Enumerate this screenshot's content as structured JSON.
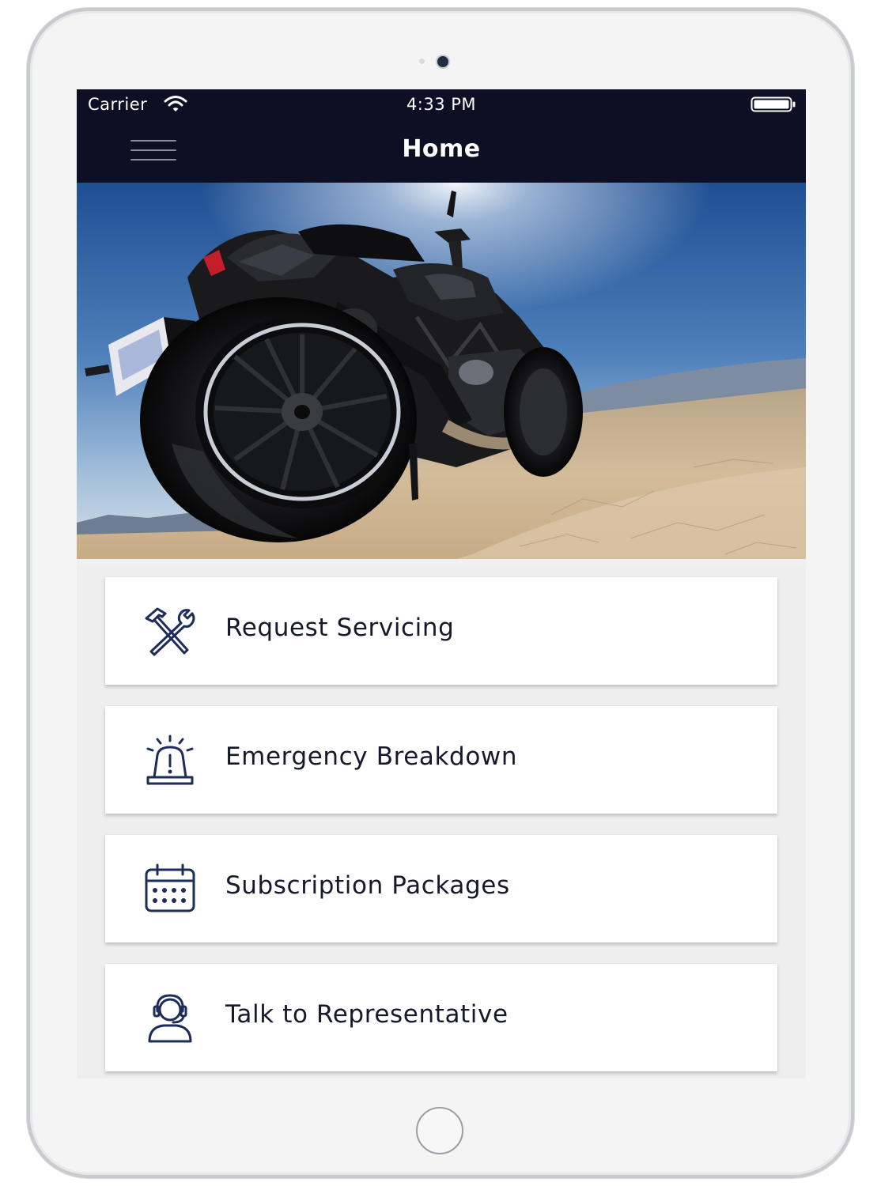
{
  "status_bar": {
    "carrier": "Carrier",
    "time": "4:33 PM",
    "wifi_icon": "wifi-icon",
    "battery_icon": "battery-icon"
  },
  "nav": {
    "title": "Home",
    "menu_icon": "hamburger-menu-icon"
  },
  "hero": {
    "description": "motorcycle-photo"
  },
  "menu_items": [
    {
      "label": "Request Servicing",
      "icon": "tools-icon"
    },
    {
      "label": "Emergency Breakdown",
      "icon": "siren-icon"
    },
    {
      "label": "Subscription Packages",
      "icon": "calendar-icon"
    },
    {
      "label": "Talk to Representative",
      "icon": "headset-icon"
    }
  ],
  "colors": {
    "navbar": "#0d1024",
    "icon": "#1c2c5b",
    "card_bg": "#ffffff",
    "list_bg": "#eeeeef"
  }
}
